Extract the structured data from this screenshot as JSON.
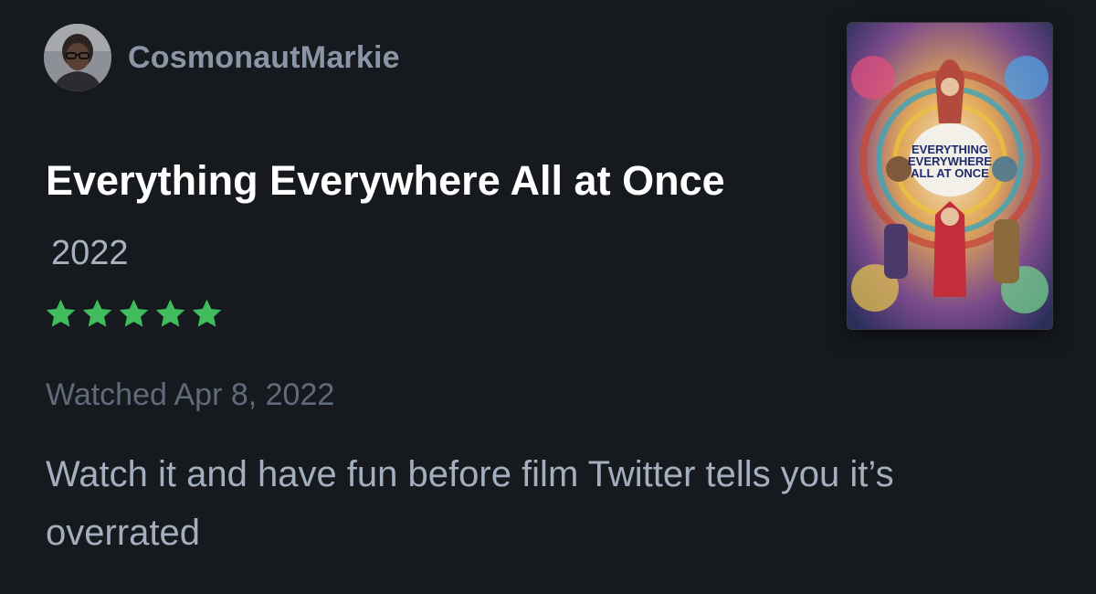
{
  "user": {
    "name": "CosmonautMarkie",
    "avatar_icon": "user-avatar"
  },
  "film": {
    "title": "Everything Everywhere All at Once",
    "year": "2022",
    "poster_title": "EVERYTHING\nEVERYWHERE\nALL AT ONCE"
  },
  "rating": {
    "stars": 5,
    "max": 5,
    "color": "#40bc5c"
  },
  "watched": "Watched Apr 8, 2022",
  "review": "Watch it and have fun before film Twitter tells you it’s overrated"
}
